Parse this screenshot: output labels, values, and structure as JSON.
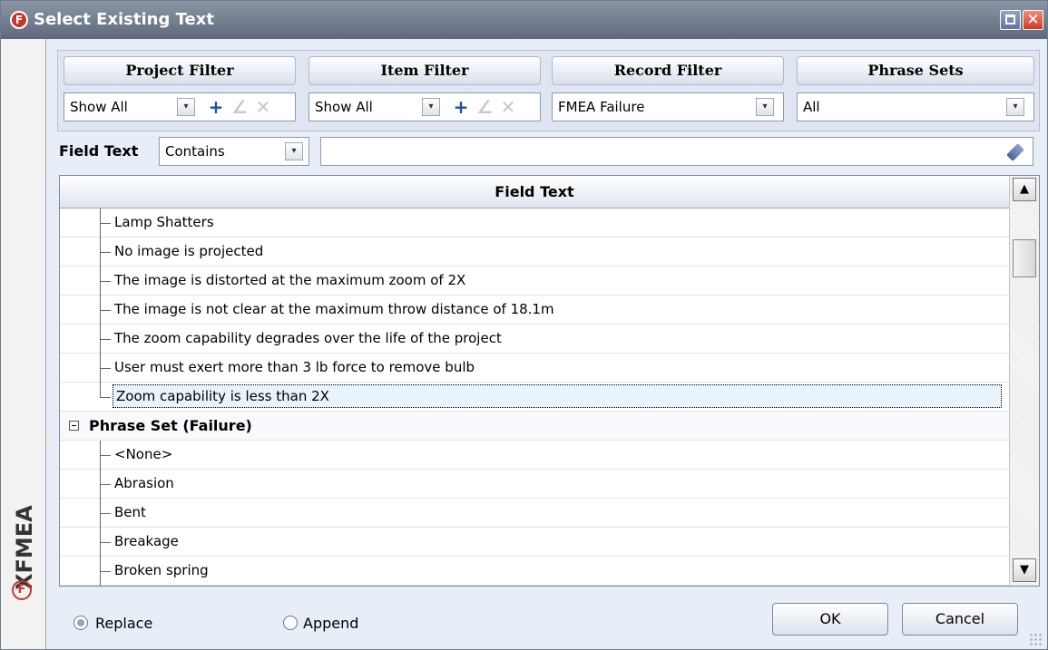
{
  "window": {
    "title": "Select Existing Text",
    "close_glyph": "✕"
  },
  "sidebar": {
    "brand": "XFMEA"
  },
  "filters": {
    "project": {
      "label": "Project Filter",
      "value": "Show All"
    },
    "item": {
      "label": "Item Filter",
      "value": "Show All"
    },
    "record": {
      "label": "Record Filter",
      "value": "FMEA Failure"
    },
    "phrase_sets": {
      "label": "Phrase Sets",
      "value": "All"
    },
    "add_glyph": "+",
    "edit_glyph": "∠",
    "delete_glyph": "✕",
    "dropdown_glyph": "▾"
  },
  "field_text": {
    "label": "Field Text",
    "operator": "Contains",
    "value": ""
  },
  "grid": {
    "header": "Field Text",
    "rows": [
      "Lamp Shatters",
      "No image is projected",
      "The image is distorted at the maximum zoom of 2X",
      "The image is not clear at the maximum throw distance of 18.1m",
      "The zoom capability degrades over the life of the project",
      "User must exert more than 3 lb force to remove bulb",
      "Zoom capability is less than 2X"
    ],
    "group": {
      "label": "Phrase Set (Failure)",
      "rows": [
        "<None>",
        "Abrasion",
        "Bent",
        "Breakage",
        "Broken spring"
      ]
    },
    "scroll_up": "▲",
    "scroll_down": "▼"
  },
  "footer": {
    "replace_label": "Replace",
    "append_label": "Append",
    "ok_label": "OK",
    "cancel_label": "Cancel",
    "mode": "Replace"
  },
  "colors": {
    "title_bar": "#6e7a8c",
    "close_button": "#d13a22",
    "brand_red": "#c0392b",
    "selection": "#e9f3fb"
  }
}
